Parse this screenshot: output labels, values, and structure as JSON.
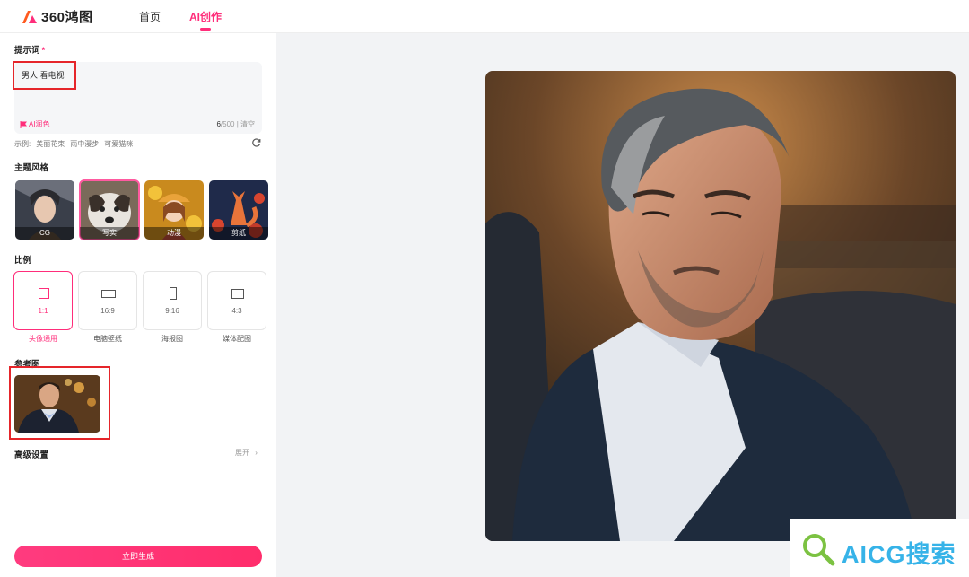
{
  "brand": {
    "name": "360鸿图",
    "color": "#ff2d7a"
  },
  "nav": [
    {
      "label": "首页",
      "active": false
    },
    {
      "label": "AI创作",
      "active": true
    }
  ],
  "prompt": {
    "label": "提示词",
    "required_mark": "*",
    "value": "男人 看电视",
    "ai_polish": "AI润色",
    "count": "6",
    "max": "/500",
    "clear": "清空"
  },
  "examples": {
    "prefix": "示例:",
    "items": [
      "美丽花束",
      "雨中漫步",
      "可爱猫咪"
    ]
  },
  "style": {
    "label": "主题风格",
    "items": [
      {
        "label": "CG",
        "selected": false
      },
      {
        "label": "写实",
        "selected": true
      },
      {
        "label": "动漫",
        "selected": false
      },
      {
        "label": "剪纸",
        "selected": false
      }
    ]
  },
  "ratio": {
    "label": "比例",
    "items": [
      {
        "value": "1:1",
        "caption": "头像通用",
        "selected": true
      },
      {
        "value": "16:9",
        "caption": "电脑壁纸",
        "selected": false
      },
      {
        "value": "9:16",
        "caption": "海报图",
        "selected": false
      },
      {
        "value": "4:3",
        "caption": "媒体配图",
        "selected": false
      }
    ]
  },
  "reference": {
    "label": "参考图"
  },
  "advanced": {
    "label": "高级设置",
    "expand": "展开"
  },
  "generate_button": "立即生成",
  "watermark": {
    "text": "AICG搜索"
  },
  "icons": {
    "refresh": "refresh-icon",
    "chevron": "chevron-right-icon",
    "polish": "flag-icon"
  }
}
